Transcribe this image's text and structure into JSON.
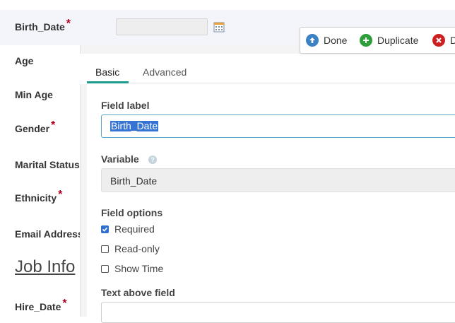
{
  "form": {
    "fields": [
      {
        "label": "Birth_Date",
        "required": true
      },
      {
        "label": "Age",
        "required": false
      },
      {
        "label": "Min Age",
        "required": false
      },
      {
        "label": "Gender",
        "required": true
      },
      {
        "label": "Marital Status",
        "required": false
      },
      {
        "label": "Ethnicity",
        "required": true
      },
      {
        "label": "Email Address",
        "required": false
      },
      {
        "label": "Hire_Date",
        "required": true
      }
    ],
    "required_marker": "*",
    "section_heading": "Job Info",
    "birth_date_value": ""
  },
  "toolbar": {
    "done_label": "Done",
    "duplicate_label": "Duplicate",
    "delete_label": "D"
  },
  "tabs": [
    {
      "label": "Basic",
      "active": true
    },
    {
      "label": "Advanced",
      "active": false
    }
  ],
  "editor": {
    "field_label_heading": "Field label",
    "field_label_value": "Birth_Date",
    "variable_heading": "Variable",
    "variable_help": "?",
    "variable_value": "Birth_Date",
    "options_heading": "Field options",
    "options": [
      {
        "label": "Required",
        "checked": true
      },
      {
        "label": "Read-only",
        "checked": false
      },
      {
        "label": "Show Time",
        "checked": false
      }
    ],
    "text_above_heading": "Text above field",
    "text_above_value": ""
  },
  "colors": {
    "accent_tab": "#1c9a8f",
    "done_icon": "#3b82c4",
    "duplicate_icon": "#2e9e3a",
    "delete_icon": "#cc2020",
    "required_marker": "#b00020",
    "selection": "#3574d4"
  },
  "icons": {
    "calendar": "calendar-icon",
    "done": "arrow-up-circle-icon",
    "duplicate": "plus-circle-icon",
    "delete": "x-circle-icon",
    "help": "help-icon",
    "check": "checkmark-icon"
  }
}
